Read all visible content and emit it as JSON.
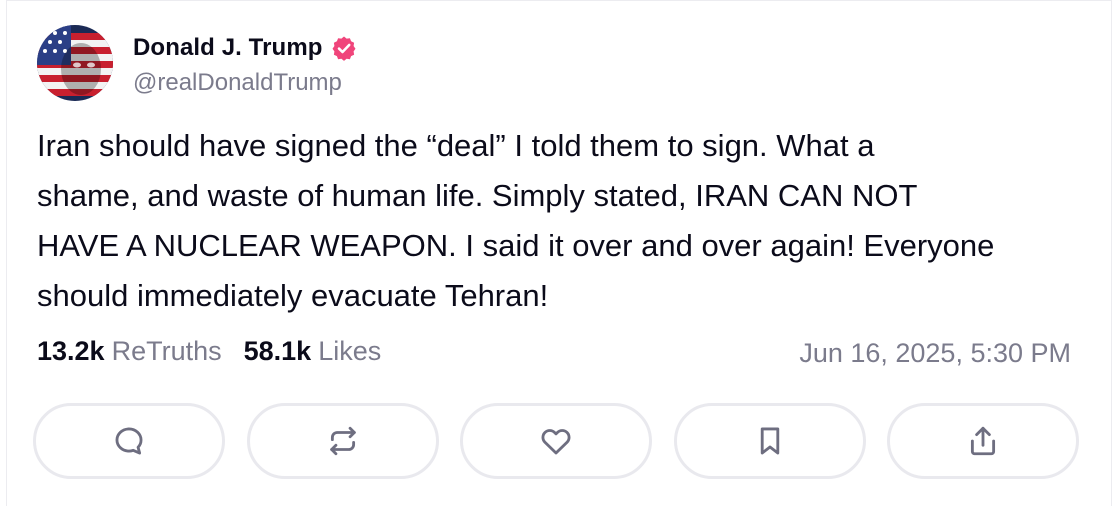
{
  "author": {
    "display_name": "Donald J. Trump",
    "handle": "@realDonaldTrump",
    "verified_color": "#f0457b",
    "avatar_icon": "flag-portrait-avatar"
  },
  "post": {
    "text": "Iran should have signed the “deal” I told them to sign. What a\nshame, and waste of human life. Simply stated, IRAN CAN NOT\nHAVE A NUCLEAR WEAPON. I said it over and over again! Everyone\nshould immediately evacuate Tehran!"
  },
  "stats": {
    "retruths_count": "13.2k",
    "retruths_label": "ReTruths",
    "likes_count": "58.1k",
    "likes_label": "Likes"
  },
  "timestamp": "Jun 16, 2025, 5:30 PM",
  "actions": [
    {
      "icon": "reply-icon"
    },
    {
      "icon": "retruth-icon"
    },
    {
      "icon": "heart-icon"
    },
    {
      "icon": "bookmark-icon"
    },
    {
      "icon": "share-icon"
    }
  ]
}
